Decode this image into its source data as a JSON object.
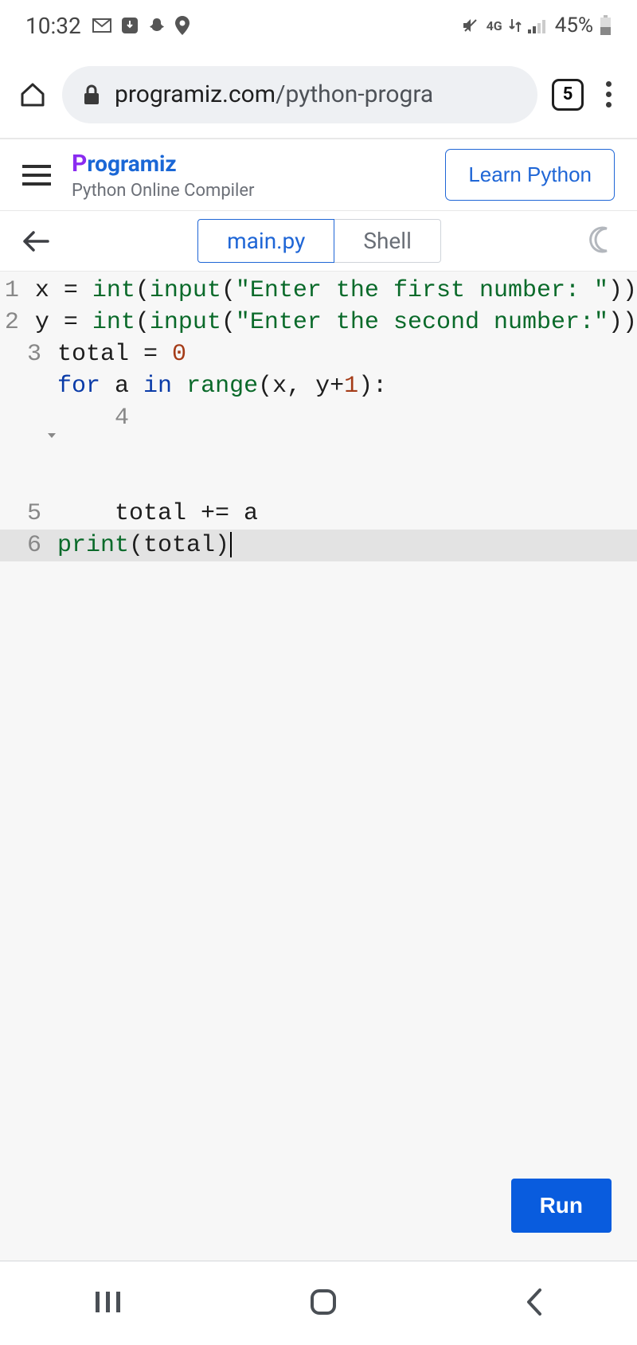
{
  "status": {
    "time": "10:32",
    "battery_text": "45%",
    "network_label": "4G"
  },
  "browser": {
    "url_domain": "programiz.com",
    "url_path": "/python-progra",
    "tab_count": "5"
  },
  "site": {
    "brand": "rogramiz",
    "subtitle": "Python Online Compiler",
    "learn_label": "Learn Python"
  },
  "tabs": {
    "main": "main.py",
    "shell": "Shell"
  },
  "code": {
    "lines": [
      {
        "n": "1"
      },
      {
        "n": "2"
      },
      {
        "n": "3"
      },
      {
        "n": "4"
      },
      {
        "n": "5"
      },
      {
        "n": "6"
      }
    ],
    "l1_str": "\"Enter the first number: \"",
    "l2_str": "\"Enter the second number:\"",
    "zero": "0",
    "one": "1"
  },
  "run_label": "Run"
}
